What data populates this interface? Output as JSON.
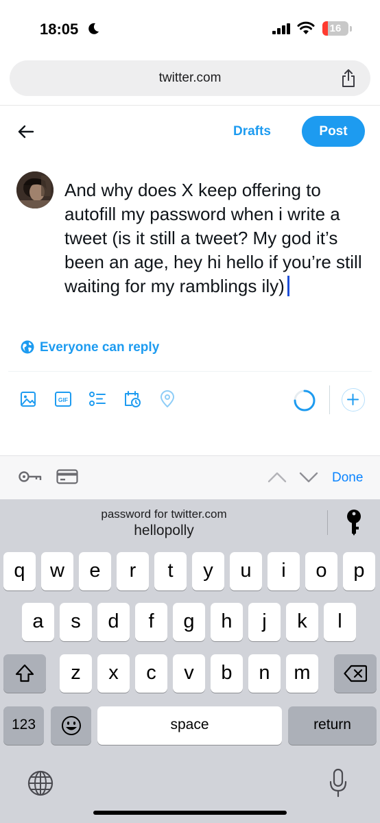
{
  "status_bar": {
    "time": "18:05",
    "battery_level": "16",
    "icons": [
      "moon-icon",
      "signal-icon",
      "wifi-icon",
      "battery-icon"
    ]
  },
  "browser": {
    "url": "twitter.com",
    "icons": [
      "share-icon"
    ]
  },
  "compose": {
    "drafts_label": "Drafts",
    "post_label": "Post",
    "tweet_text": "And why does X keep offering to autofill my password when i write a tweet (is it still a tweet? My god it’s been an age, hey hi hello if you’re still waiting for my ramblings ily)",
    "reply_setting": "Everyone can reply",
    "accent_color": "#1d9bf0"
  },
  "toolbar": {
    "icons": [
      "image-icon",
      "gif-icon",
      "poll-icon",
      "schedule-icon",
      "location-icon",
      "character-progress-icon",
      "add-thread-icon"
    ]
  },
  "accessory_bar": {
    "done_label": "Done",
    "icons": [
      "key-icon",
      "credit-card-icon",
      "chevron-up-icon",
      "chevron-down-icon"
    ]
  },
  "keyboard": {
    "suggestion_title": "password for twitter.com",
    "suggestion_value": "hellopolly",
    "row1": [
      "q",
      "w",
      "e",
      "r",
      "t",
      "y",
      "u",
      "i",
      "o",
      "p"
    ],
    "row2": [
      "a",
      "s",
      "d",
      "f",
      "g",
      "h",
      "j",
      "k",
      "l"
    ],
    "row3": [
      "z",
      "x",
      "c",
      "v",
      "b",
      "n",
      "m"
    ],
    "numbers_label": "123",
    "space_label": "space",
    "return_label": "return",
    "icons": [
      "shift-icon",
      "backspace-icon",
      "emoji-icon",
      "globe-icon",
      "microphone-icon"
    ]
  }
}
